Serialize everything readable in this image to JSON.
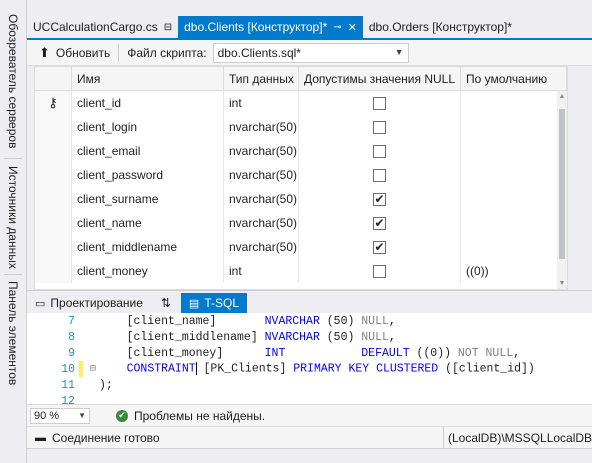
{
  "side_panels": [
    "Обозреватель серверов",
    "Источники данных",
    "Панель элементов"
  ],
  "tabs": [
    {
      "label": "UCCalculationCargo.cs",
      "active": false,
      "icon": "pin-icon"
    },
    {
      "label": "dbo.Clients [Конструктор]*",
      "active": true
    },
    {
      "label": "dbo.Orders [Конструктор]*",
      "active": false
    }
  ],
  "toolbar": {
    "refresh_label": "Обновить",
    "script_file_label": "Файл скрипта:",
    "script_file_value": "dbo.Clients.sql*"
  },
  "grid": {
    "columns": [
      "Имя",
      "Тип данных",
      "Допустимы значения NULL",
      "По умолчанию"
    ],
    "rows": [
      {
        "name": "client_id",
        "type": "int",
        "nullable": false,
        "default": "",
        "key": true
      },
      {
        "name": "client_login",
        "type": "nvarchar(50)",
        "nullable": false,
        "default": ""
      },
      {
        "name": "client_email",
        "type": "nvarchar(50)",
        "nullable": false,
        "default": ""
      },
      {
        "name": "client_password",
        "type": "nvarchar(50)",
        "nullable": false,
        "default": ""
      },
      {
        "name": "client_surname",
        "type": "nvarchar(50)",
        "nullable": true,
        "default": ""
      },
      {
        "name": "client_name",
        "type": "nvarchar(50)",
        "nullable": true,
        "default": ""
      },
      {
        "name": "client_middlename",
        "type": "nvarchar(50)",
        "nullable": true,
        "default": ""
      },
      {
        "name": "client_money",
        "type": "int",
        "nullable": false,
        "default": "((0))"
      }
    ]
  },
  "pane_tabs": {
    "design": "Проектирование",
    "swap": "⇅",
    "tsql": "T-SQL"
  },
  "code": {
    "lines": [
      {
        "n": "7",
        "text": "    [client_name]       NVARCHAR (50) NULL,"
      },
      {
        "n": "8",
        "text": "    [client_middlename] NVARCHAR (50) NULL,"
      },
      {
        "n": "9",
        "text": "    [client_money]      INT           DEFAULT ((0)) NOT NULL,"
      },
      {
        "n": "10",
        "text": "    CONSTRAINT [PK_Clients] PRIMARY KEY CLUSTERED ([client_id])"
      },
      {
        "n": "11",
        "text": ");"
      },
      {
        "n": "12",
        "text": ""
      }
    ]
  },
  "editor_status": {
    "zoom": "90 %",
    "message": "Проблемы не найдены."
  },
  "connection": {
    "status": "Соединение готово",
    "server": "(LocalDB)\\MSSQLLocalDB"
  },
  "colors": {
    "accent": "#007acc",
    "keyword": "#0000ff",
    "line_number": "#2b91af",
    "ok_green": "#388a34"
  }
}
